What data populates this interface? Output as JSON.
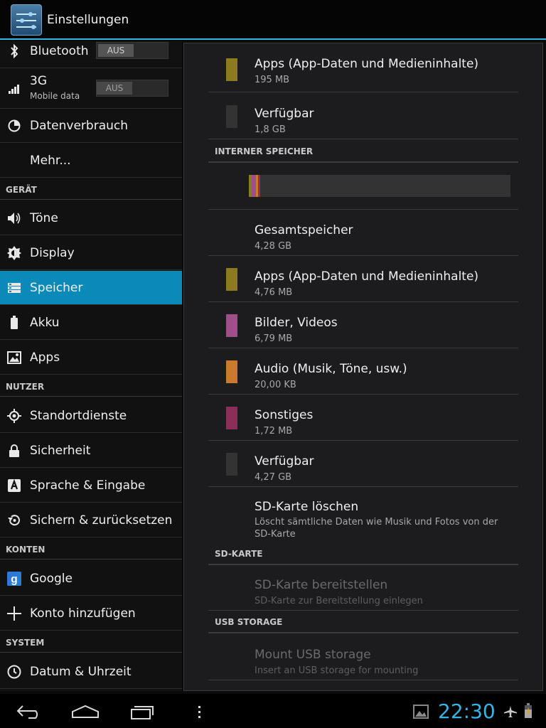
{
  "app": {
    "title": "Einstellungen"
  },
  "sidebar": {
    "bluetooth": {
      "label": "Bluetooth",
      "toggle": "AUS"
    },
    "mobile": {
      "label": "3G",
      "sublabel": "Mobile data",
      "toggle": "AUS"
    },
    "datenverbrauch": "Datenverbrauch",
    "mehr": "Mehr...",
    "section_geraet": "GERÄT",
    "toene": "Töne",
    "display": "Display",
    "speicher": "Speicher",
    "akku": "Akku",
    "apps": "Apps",
    "section_nutzer": "NUTZER",
    "standort": "Standortdienste",
    "sicherheit": "Sicherheit",
    "sprache": "Sprache & Eingabe",
    "sichern": "Sichern & zurücksetzen",
    "section_konten": "KONTEN",
    "google": "Google",
    "konto": "Konto hinzufügen",
    "section_system": "SYSTEM",
    "datum": "Datum & Uhrzeit"
  },
  "storage": {
    "top_items": [
      {
        "title": "Apps (App-Daten und Medieninhalte)",
        "value": "195 MB",
        "color": "#8c7a1f"
      },
      {
        "title": "Verfügbar",
        "value": "1,8 GB",
        "color": "#333333"
      }
    ],
    "internal_header": "INTERNER SPEICHER",
    "usage_bar": [
      {
        "name": "apps",
        "fraction": 0.011,
        "color": "#8c7a1f"
      },
      {
        "name": "bilder-videos",
        "fraction": 0.016,
        "color": "#9e4f8a"
      },
      {
        "name": "audio",
        "fraction": 0.004,
        "color": "#c97a2a"
      },
      {
        "name": "sonstiges",
        "fraction": 0.004,
        "color": "#8a2e5a"
      }
    ],
    "internal_items": [
      {
        "title": "Gesamtspeicher",
        "value": "4,28 GB",
        "color": ""
      },
      {
        "title": "Apps (App-Daten und Medieninhalte)",
        "value": "4,76 MB",
        "color": "#8c7a1f"
      },
      {
        "title": "Bilder, Videos",
        "value": "6,79 MB",
        "color": "#9e4f8a"
      },
      {
        "title": "Audio (Musik, Töne, usw.)",
        "value": "20,00 KB",
        "color": "#c97a2a"
      },
      {
        "title": "Sonstiges",
        "value": "1,72 MB",
        "color": "#8a2e5a"
      },
      {
        "title": "Verfügbar",
        "value": "4,27 GB",
        "color": "#333333"
      }
    ],
    "sd_erase": {
      "title": "SD-Karte löschen",
      "desc": "Löscht sämtliche Daten wie Musik und Fotos von der SD-Karte"
    },
    "sd_header": "SD-KARTE",
    "sd_mount": {
      "title": "SD-Karte bereitstellen",
      "desc": "SD-Karte zur Bereitstellung einlegen"
    },
    "usb_header": "USB STORAGE",
    "usb_mount": {
      "title": "Mount USB storage",
      "desc": "Insert an USB storage for mounting"
    }
  },
  "statusbar": {
    "time": "22:30",
    "accent": "#33b5e5"
  }
}
